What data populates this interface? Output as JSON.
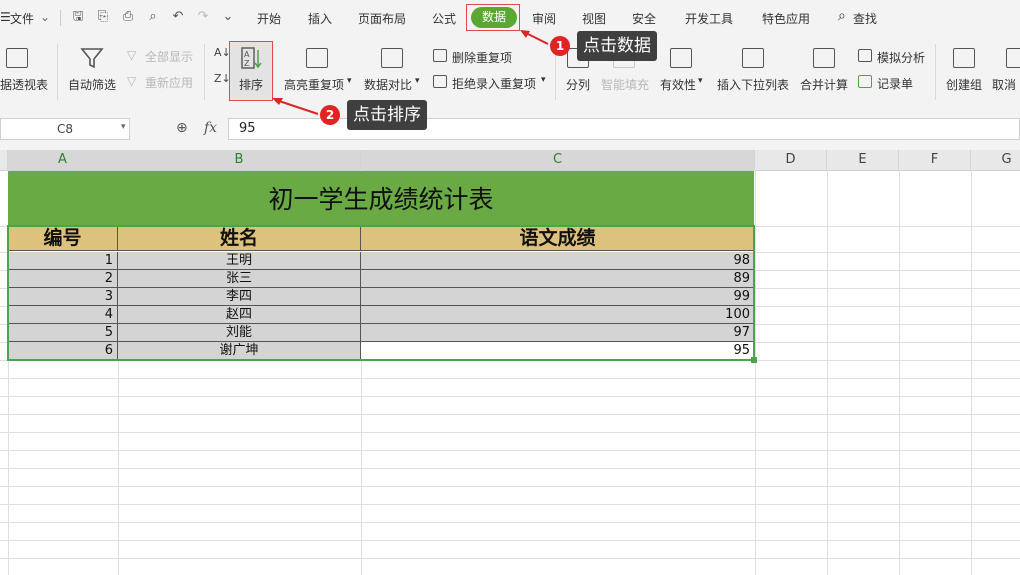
{
  "menu": {
    "file_label": "文件",
    "tabs": [
      "开始",
      "插入",
      "页面布局",
      "公式",
      "数据",
      "审阅",
      "视图",
      "安全",
      "开发工具",
      "特色应用"
    ],
    "search_label": "查找"
  },
  "ribbon": {
    "pivot_label": "据透视表",
    "autofilter_label": "自动筛选",
    "show_all_label": "全部显示",
    "reapply_label": "重新应用",
    "sort_label": "排序",
    "highlight_dup_label": "高亮重复项",
    "compare_label": "数据对比",
    "remove_dup_label": "删除重复项",
    "reject_dup_label": "拒绝录入重复项",
    "split_label": "分列",
    "smart_fill_label": "智能填充",
    "validity_label": "有效性",
    "insert_dropdown_label": "插入下拉列表",
    "consolidate_label": "合并计算",
    "whatif_label": "模拟分析",
    "form_label": "记录单",
    "group_label": "创建组",
    "ungroup_label": "取消"
  },
  "formula_bar": {
    "cell_ref": "C8",
    "fx_label": "fx",
    "value": "95"
  },
  "columns": [
    "A",
    "B",
    "C",
    "D",
    "E",
    "F",
    "G"
  ],
  "sheet": {
    "title": "初一学生成绩统计表",
    "headers": [
      "编号",
      "姓名",
      "语文成绩"
    ],
    "rows": [
      {
        "id": "1",
        "name": "王明",
        "score": "98"
      },
      {
        "id": "2",
        "name": "张三",
        "score": "89"
      },
      {
        "id": "3",
        "name": "李四",
        "score": "99"
      },
      {
        "id": "4",
        "name": "赵四",
        "score": "100"
      },
      {
        "id": "5",
        "name": "刘能",
        "score": "97"
      },
      {
        "id": "6",
        "name": "谢广坤",
        "score": "95"
      }
    ]
  },
  "annotations": [
    {
      "number": "1",
      "text": "点击数据"
    },
    {
      "number": "2",
      "text": "点击排序"
    }
  ],
  "colors": {
    "accent_green": "#5aa832",
    "title_fill": "#6aaa45",
    "header_fill": "#dcc27d",
    "annotation_red": "#e02424"
  }
}
